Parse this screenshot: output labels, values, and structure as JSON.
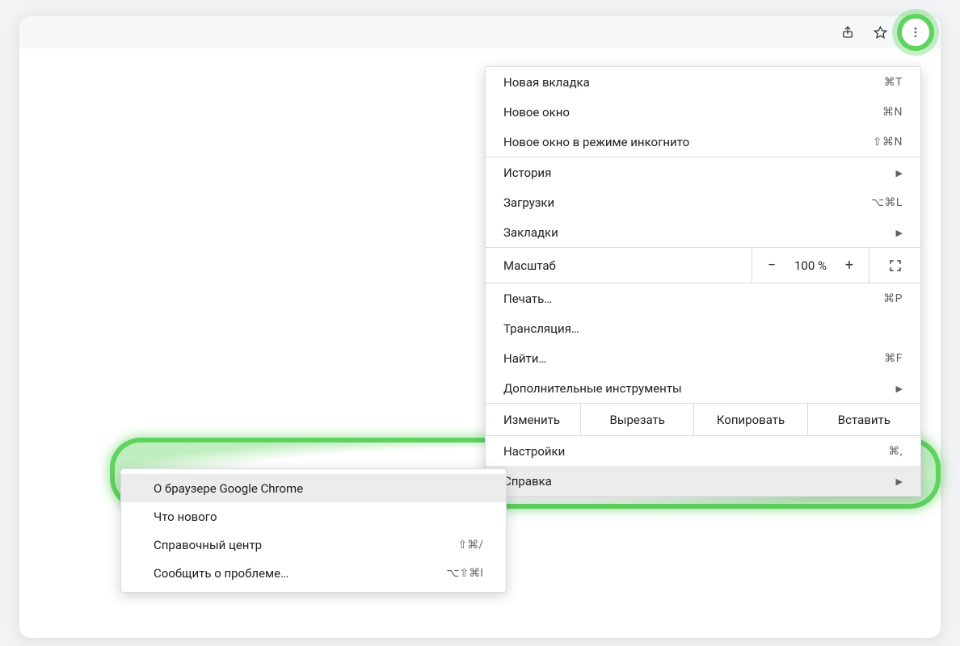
{
  "menu": {
    "new_tab": {
      "label": "Новая вкладка",
      "shortcut": "⌘T"
    },
    "new_window": {
      "label": "Новое окно",
      "shortcut": "⌘N"
    },
    "incognito": {
      "label": "Новое окно в режиме инкогнито",
      "shortcut": "⇧⌘N"
    },
    "history": {
      "label": "История"
    },
    "downloads": {
      "label": "Загрузки",
      "shortcut": "⌥⌘L"
    },
    "bookmarks": {
      "label": "Закладки"
    },
    "zoom": {
      "label": "Масштаб",
      "value": "100 %",
      "minus": "−",
      "plus": "+"
    },
    "print": {
      "label": "Печать…",
      "shortcut": "⌘P"
    },
    "cast": {
      "label": "Трансляция…"
    },
    "find": {
      "label": "Найти…",
      "shortcut": "⌘F"
    },
    "more_tools": {
      "label": "Дополнительные инструменты"
    },
    "edit": {
      "label": "Изменить",
      "cut": "Вырезать",
      "copy": "Копировать",
      "paste": "Вставить"
    },
    "settings": {
      "label": "Настройки",
      "shortcut": "⌘,"
    },
    "help": {
      "label": "Справка"
    }
  },
  "submenu": {
    "about": {
      "label": "О браузере Google Chrome"
    },
    "whats_new": {
      "label": "Что нового"
    },
    "help_center": {
      "label": "Справочный центр",
      "shortcut": "⇧⌘/"
    },
    "report": {
      "label": "Сообщить о проблеме…",
      "shortcut": "⌥⇧⌘I"
    }
  }
}
